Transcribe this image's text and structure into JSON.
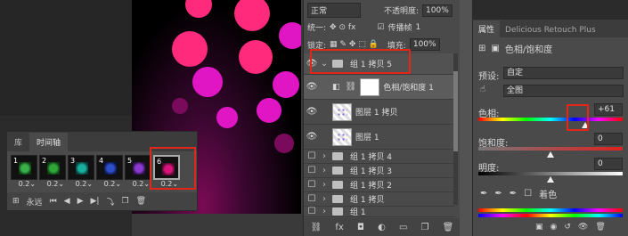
{
  "timeline": {
    "tabs": [
      "库",
      "时间轴"
    ],
    "frames": [
      {
        "num": "1",
        "delay": "0.2",
        "color": "#39b04a"
      },
      {
        "num": "2",
        "delay": "0.2",
        "color": "#2fa83a"
      },
      {
        "num": "3",
        "delay": "0.2",
        "color": "#19b0a0"
      },
      {
        "num": "4",
        "delay": "0.2",
        "color": "#2d4fc8"
      },
      {
        "num": "5",
        "delay": "0.2",
        "color": "#8a3ad0"
      },
      {
        "num": "6",
        "delay": "0.2",
        "color": "#d8157a"
      }
    ],
    "loop": "永远"
  },
  "layers": {
    "blend_mode": "正常",
    "opacity_label": "不透明度:",
    "opacity": "100%",
    "unify_label": "统一:",
    "propagate": "传播帧",
    "propagate_num": "1",
    "lock_label": "锁定:",
    "fill_label": "填充:",
    "fill": "100%",
    "items": [
      {
        "name": "组 1 拷贝 5",
        "type": "group",
        "visible": true,
        "expanded": true
      },
      {
        "name": "色相/饱和度 1",
        "type": "adjust",
        "visible": true
      },
      {
        "name": "图层 1 拷贝",
        "type": "pixel",
        "visible": true
      },
      {
        "name": "图层 1",
        "type": "pixel",
        "visible": true
      },
      {
        "name": "组 1 拷贝 4",
        "type": "group",
        "visible": false
      },
      {
        "name": "组 1 拷贝 3",
        "type": "group",
        "visible": false
      },
      {
        "name": "组 1 拷贝 2",
        "type": "group",
        "visible": false
      },
      {
        "name": "组 1 拷贝",
        "type": "group",
        "visible": false
      },
      {
        "name": "组 1",
        "type": "group",
        "visible": false
      }
    ]
  },
  "properties": {
    "tabs": [
      "属性",
      "Delicious Retouch Plus"
    ],
    "title": "色相/饱和度",
    "preset_label": "预设:",
    "preset": "自定",
    "channel": "全图",
    "hue_label": "色相:",
    "hue": "+61",
    "saturation_label": "饱和度:",
    "saturation": "0",
    "lightness_label": "明度:",
    "lightness": "0",
    "colorize_label": "着色"
  }
}
